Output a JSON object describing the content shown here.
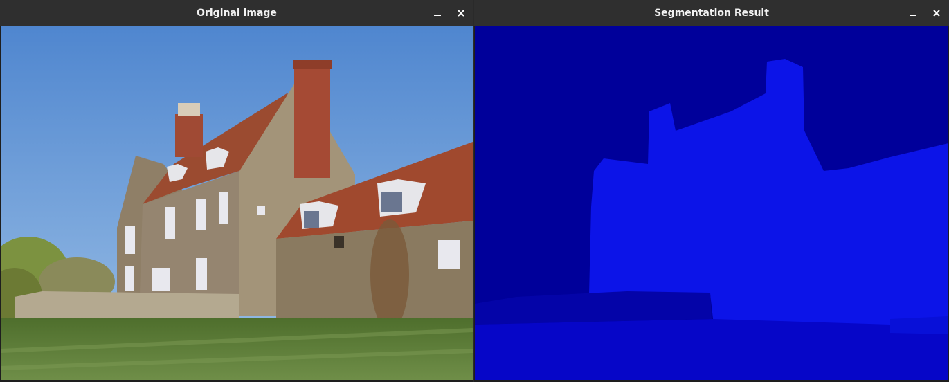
{
  "windows": {
    "left": {
      "title": "Original image",
      "minimize_icon": "minimize-icon",
      "close_icon": "close-icon"
    },
    "right": {
      "title": "Segmentation Result",
      "minimize_icon": "minimize-icon",
      "close_icon": "close-icon"
    }
  },
  "colors": {
    "titlebar": "#2f2f2f",
    "sky": "#6fa0d8",
    "roof": "#9a4a2e",
    "stone": "#8c7a62",
    "grass": "#5a7a3a",
    "seg_background": "#00009a",
    "seg_building": "#0c14e8",
    "seg_ground": "#0606c8",
    "seg_wall": "#0404a8"
  }
}
